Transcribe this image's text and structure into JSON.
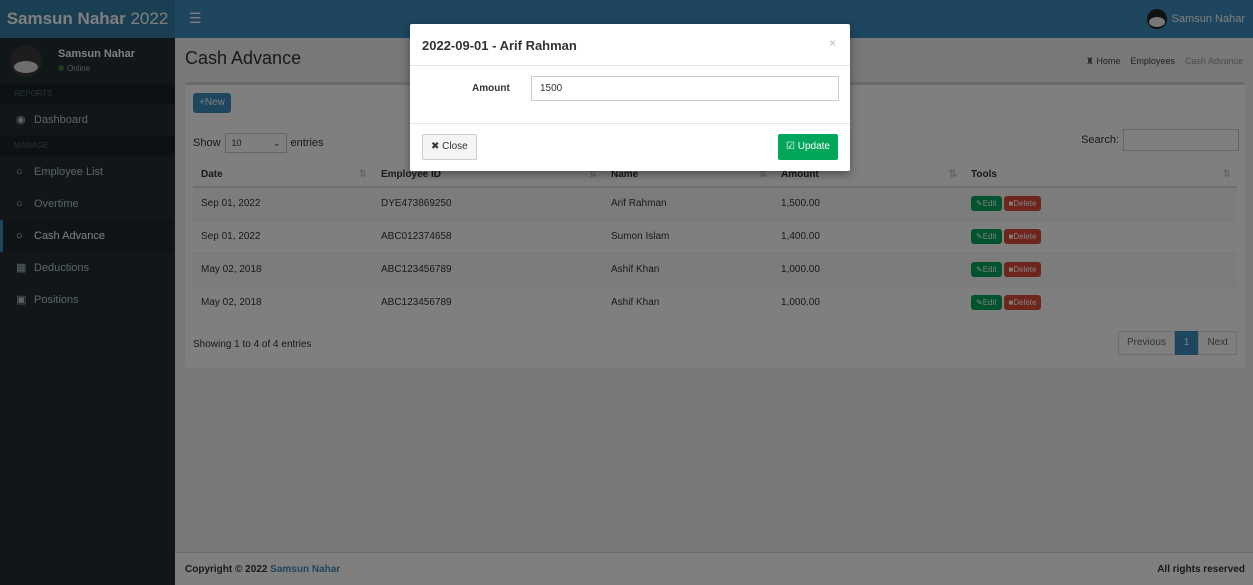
{
  "app": {
    "title_bold": "Samsun Nahar",
    "title_year": "2022",
    "menu_icon": "hamburger-icon"
  },
  "topbar": {
    "user_name": "Samsun Nahar"
  },
  "sidebar": {
    "user": {
      "name": "Samsun Nahar",
      "status": "Online"
    },
    "header_reports": "REPORTS",
    "header_manage": "MANAGE",
    "items": [
      {
        "label": "Dashboard",
        "icon": "dashboard-icon"
      },
      {
        "label": "Employee List",
        "icon": "circle-icon"
      },
      {
        "label": "Overtime",
        "icon": "circle-icon"
      },
      {
        "label": "Cash Advance",
        "icon": "circle-icon"
      },
      {
        "label": "Deductions",
        "icon": "file-icon"
      },
      {
        "label": "Positions",
        "icon": "briefcase-icon"
      }
    ]
  },
  "page": {
    "title": "Cash Advance",
    "breadcrumb": [
      "Home",
      "Employees",
      "Cash Advance"
    ]
  },
  "table_controls": {
    "new_label": "New",
    "show_label": "Show",
    "entries_value": "10",
    "entries_label": "entries",
    "search_label": "Search:"
  },
  "table": {
    "headers": [
      "Date",
      "Employee ID",
      "Name",
      "Amount",
      "Tools"
    ],
    "rows": [
      {
        "date": "Sep 01, 2022",
        "id": "DYE473869250",
        "name": "Arif Rahman",
        "amount": "1,500.00"
      },
      {
        "date": "Sep 01, 2022",
        "id": "ABC012374658",
        "name": "Sumon Islam",
        "amount": "1,400.00"
      },
      {
        "date": "May 02, 2018",
        "id": "ABC123456789",
        "name": "Ashif Khan",
        "amount": "1,000.00"
      },
      {
        "date": "May 02, 2018",
        "id": "ABC123456789",
        "name": "Ashif Khan",
        "amount": "1,000.00"
      }
    ],
    "edit_label": "Edit",
    "delete_label": "Delete",
    "info": "Showing 1 to 4 of 4 entries",
    "pager": {
      "prev": "Previous",
      "page": "1",
      "next": "Next"
    }
  },
  "footer": {
    "copyright": "Copyright © 2022",
    "brand": "Samsun Nahar",
    "rights": "All rights reserved"
  },
  "modal": {
    "title": "2022-09-01 - Arif Rahman",
    "close_x": "×",
    "amount_label": "Amount",
    "amount_value": "1500",
    "close_label": "Close",
    "update_label": "Update"
  }
}
